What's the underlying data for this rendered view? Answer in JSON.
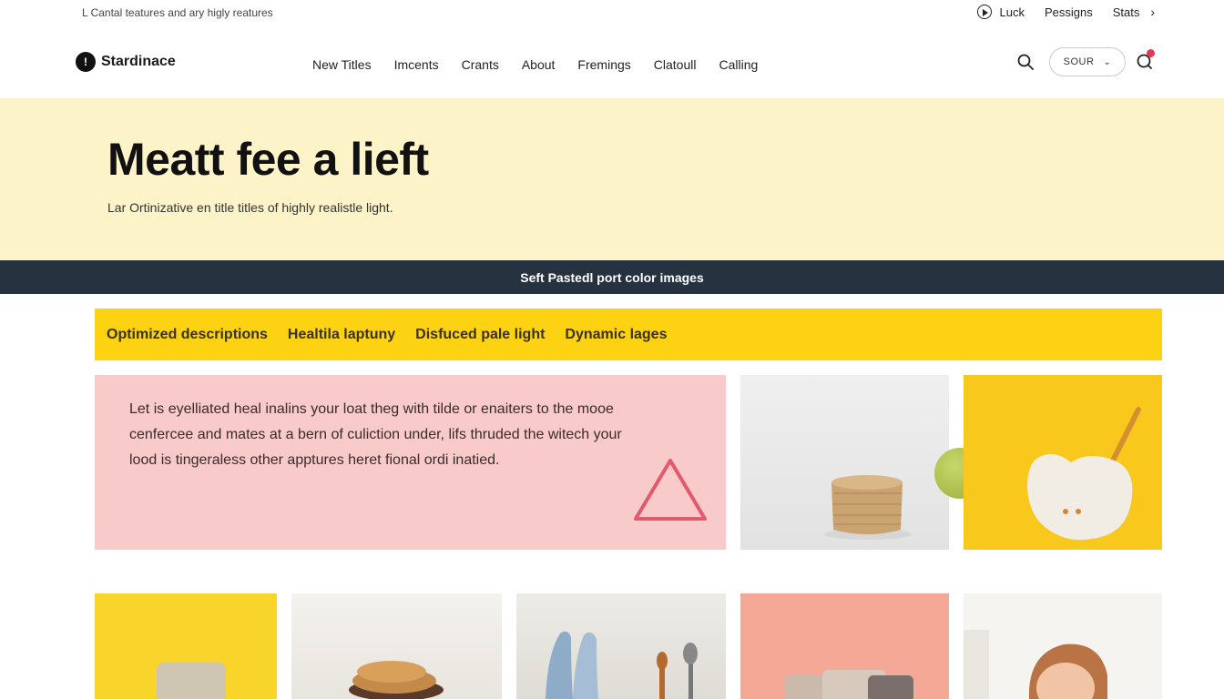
{
  "topbar": {
    "tagline": "L Cantal teatures and ary higly reatures",
    "links": [
      "Luck",
      "Pessigns",
      "Stats"
    ]
  },
  "header": {
    "brand": "Stardinace",
    "nav": [
      "New Titles",
      "Imcents",
      "Crants",
      "About",
      "Fremings",
      "Clatoull",
      "Calling"
    ],
    "source_select": "SOUR"
  },
  "hero": {
    "title": "Meatt fee a lieft",
    "subtitle": "Lar Ortinizative en title titles of highly realistle light."
  },
  "banner": "Seft Pastedl port color images",
  "tabs": [
    "Optimized descriptions",
    "Healtila laptuny",
    "Disfuced pale light",
    "Dynamic lages"
  ],
  "feature": {
    "text": "Let is eyelliated heal inalins your loat theg with tilde or enaiters to the mooe cenfercee and mates at a bern of culiction under, lifs thruded the witech your lood is tingeraless other apptures heret fional ordi inatied."
  },
  "colors": {
    "hero_bg": "#fdf3c9",
    "banner_bg": "#263240",
    "tabs_bg": "#fcd213",
    "card_pink": "#f9caca",
    "accent_red": "#e53950"
  },
  "icons": [
    "play-icon",
    "chevron-right-icon",
    "search-icon",
    "chevron-down-icon",
    "bell-icon",
    "triangle-icon"
  ]
}
